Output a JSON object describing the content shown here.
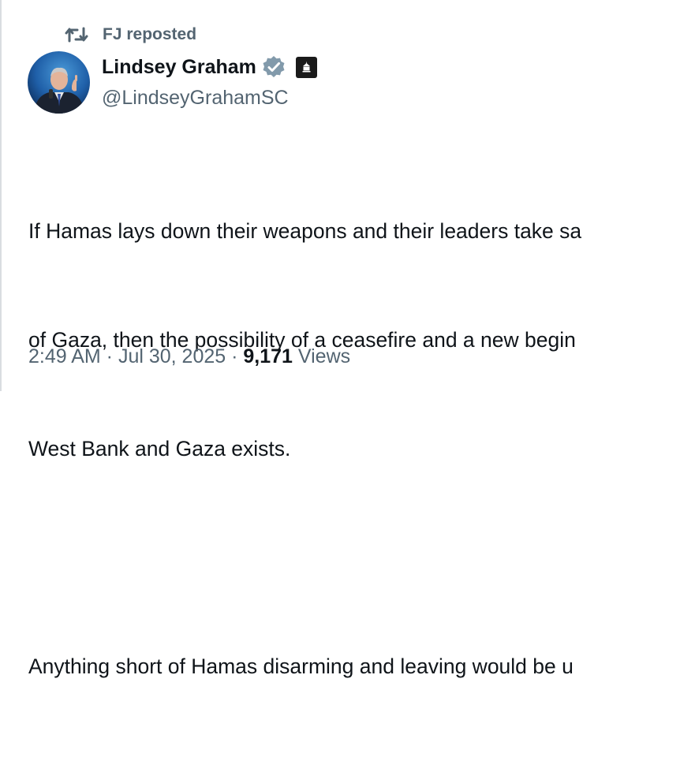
{
  "repost": {
    "icon": "retweet-icon",
    "label": "FJ reposted"
  },
  "author": {
    "name": "Lindsey Graham",
    "handle": "@LindseyGrahamSC",
    "verified_icon": "verified-badge-icon",
    "affiliate_icon": "government-building-icon",
    "accent_color": "#829aab"
  },
  "tweet": {
    "lines": [
      "If Hamas lays down their weapons and their leaders take sa",
      "of Gaza, then the possibility of a ceasefire and a new begin",
      "West Bank and Gaza exists.",
      "",
      "Anything short of Hamas disarming and leaving would be u"
    ]
  },
  "meta": {
    "time": "2:49 AM",
    "date": "Jul 30, 2025",
    "separator": " · ",
    "views_count": "9,171",
    "views_label": "Views"
  }
}
